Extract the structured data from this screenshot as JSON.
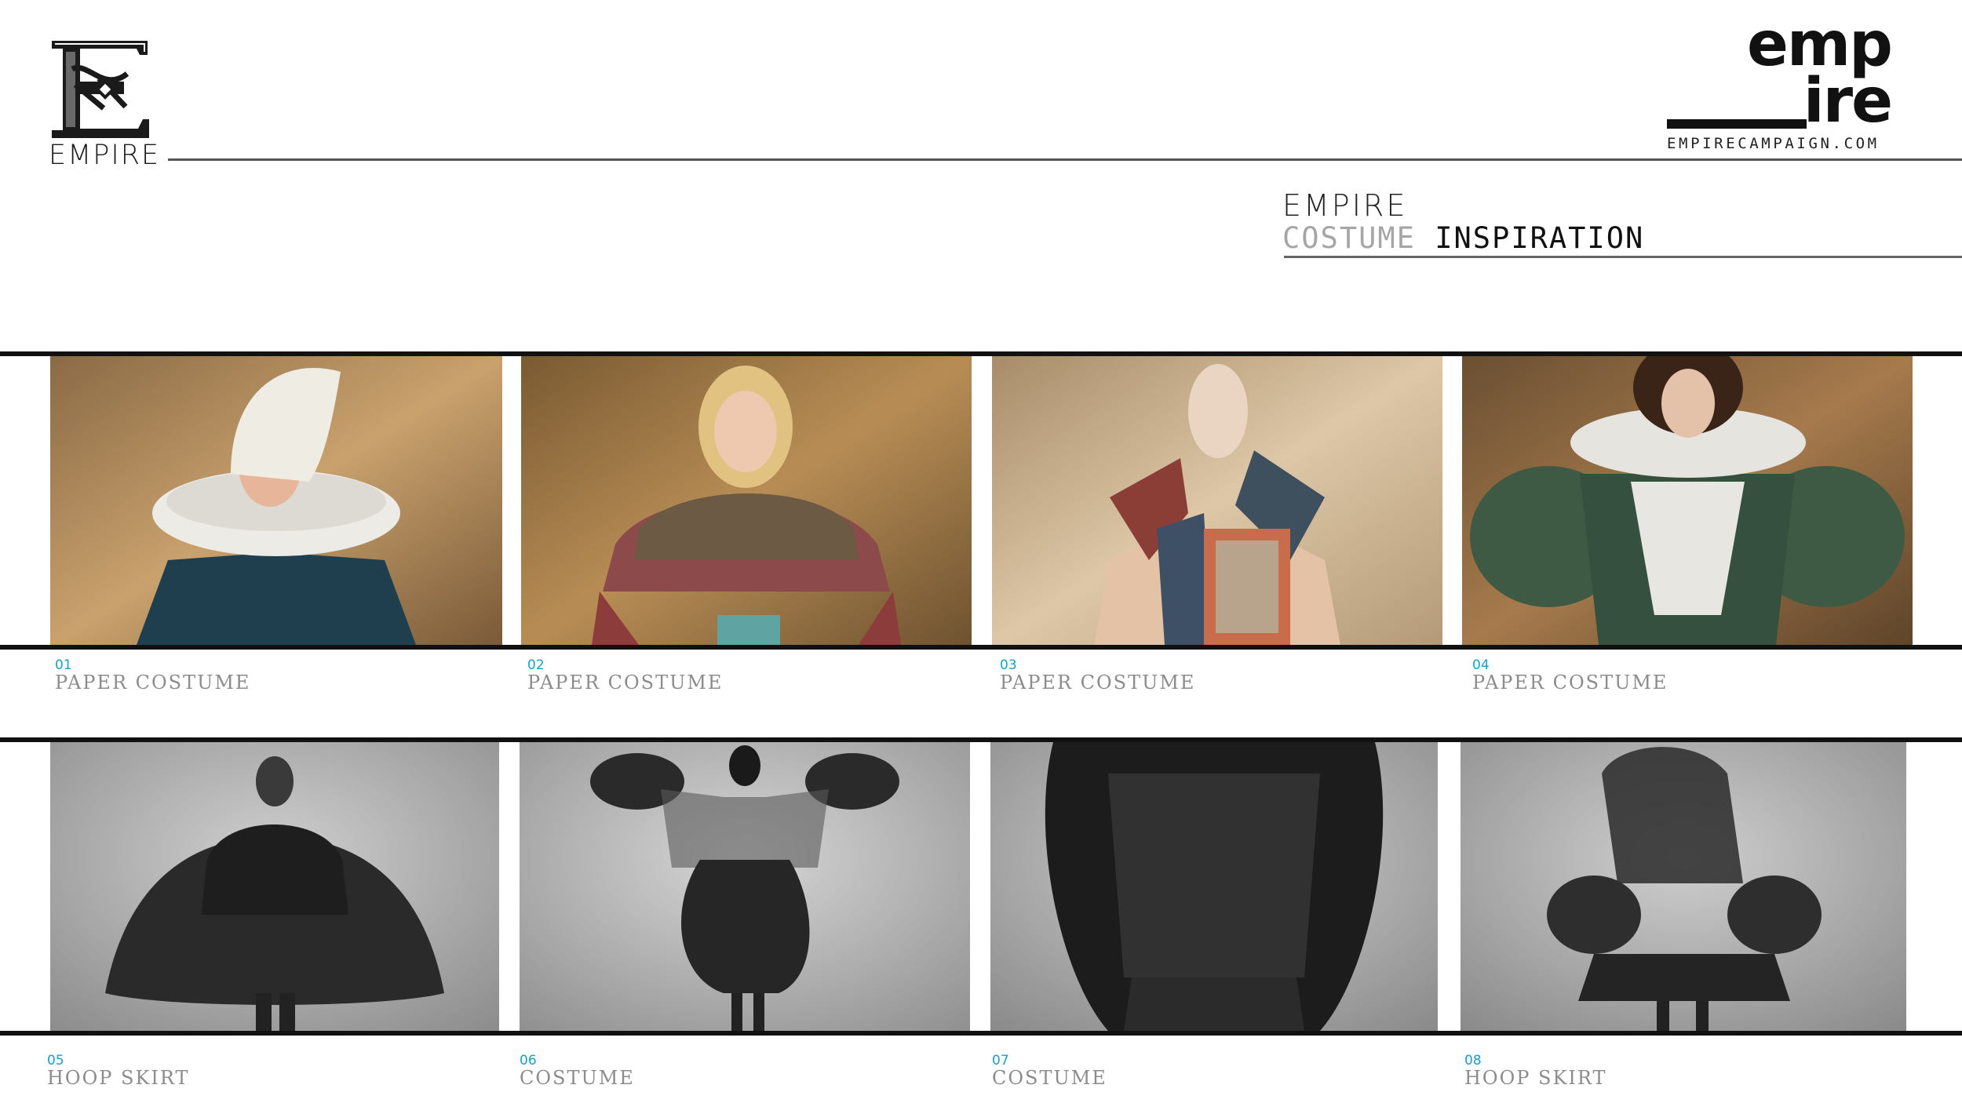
{
  "header": {
    "logo_left_text": "EMPIRE",
    "brand_right_top": "emp",
    "brand_right_bottom": "ire",
    "brand_right_url": "EMPIRECAMPAIGN.COM"
  },
  "title": {
    "line1": "EMPIRE",
    "line2_light": "COSTUME",
    "line2_dark": "INSPIRATION"
  },
  "items": [
    {
      "number": "01",
      "label": "PAPER COSTUME"
    },
    {
      "number": "02",
      "label": "PAPER COSTUME"
    },
    {
      "number": "03",
      "label": "PAPER COSTUME"
    },
    {
      "number": "04",
      "label": "PAPER COSTUME"
    },
    {
      "number": "05",
      "label": "HOOP SKIRT"
    },
    {
      "number": "06",
      "label": "COSTUME"
    },
    {
      "number": "07",
      "label": "COSTUME"
    },
    {
      "number": "08",
      "label": "HOOP SKIRT"
    }
  ],
  "colors": {
    "accent_number": "#19a0c8",
    "caption_grey": "#8c8c8c",
    "rule": "#111111"
  }
}
